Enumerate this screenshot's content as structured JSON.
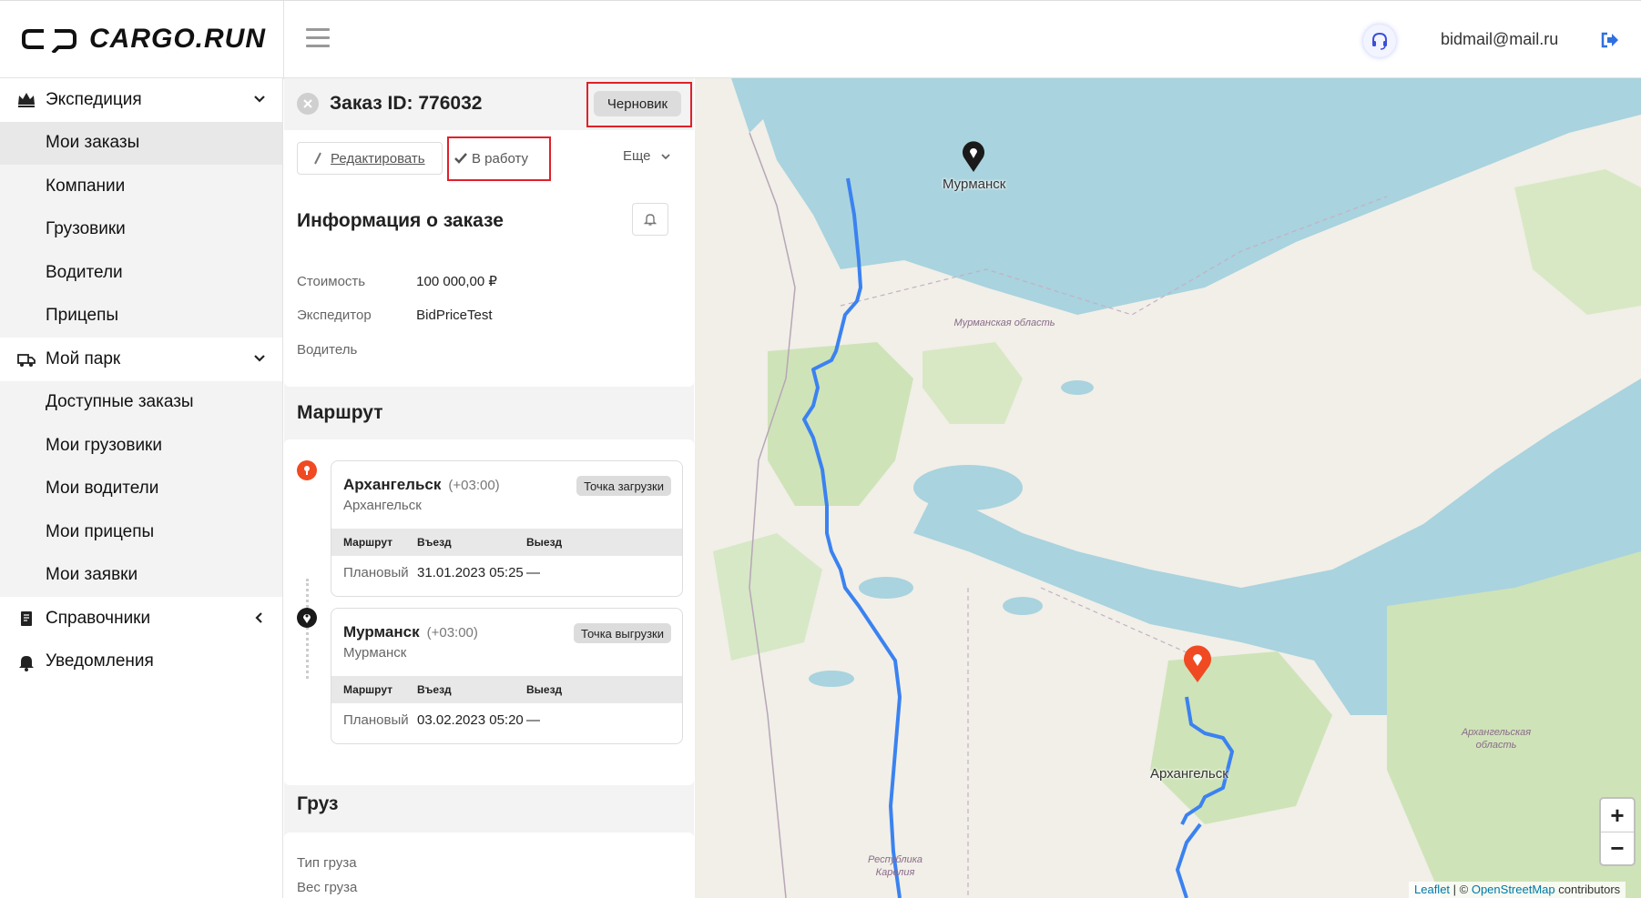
{
  "header": {
    "logo_text": "CARGO.RUN",
    "user_email": "bidmail@mail.ru"
  },
  "sidebar": {
    "items": [
      {
        "label": "Экспедиция",
        "icon": "crown-icon",
        "type": "parent",
        "chevron": "down"
      },
      {
        "label": "Мои заказы",
        "type": "child",
        "active": true
      },
      {
        "label": "Компании",
        "type": "child"
      },
      {
        "label": "Грузовики",
        "type": "child"
      },
      {
        "label": "Водители",
        "type": "child"
      },
      {
        "label": "Прицепы",
        "type": "child"
      },
      {
        "label": "Мой парк",
        "icon": "truck-icon",
        "type": "parent",
        "chevron": "down"
      },
      {
        "label": "Доступные заказы",
        "type": "child"
      },
      {
        "label": "Мои грузовики",
        "type": "child"
      },
      {
        "label": "Мои водители",
        "type": "child"
      },
      {
        "label": "Мои прицепы",
        "type": "child"
      },
      {
        "label": "Мои заявки",
        "type": "child"
      },
      {
        "label": "Справочники",
        "icon": "book-icon",
        "type": "parent",
        "chevron": "left"
      },
      {
        "label": "Уведомления",
        "icon": "bell-icon",
        "type": "parent"
      }
    ]
  },
  "order": {
    "title": "Заказ ID: 776032",
    "status": "Черновик",
    "edit_label": "Редактировать",
    "work_label": "В работу",
    "more_label": "Еще",
    "info_title": "Информация о заказе",
    "info": [
      {
        "key": "Стоимость",
        "value": "100 000,00 ₽"
      },
      {
        "key": "Экспедитор",
        "value": "BidPriceTest"
      },
      {
        "key": "Водитель",
        "value": ""
      }
    ],
    "route_title": "Маршрут",
    "route": [
      {
        "city": "Архангельск",
        "tz": "(+03:00)",
        "sub": "Архангельск",
        "badge": "Точка загрузки",
        "head": [
          "Маршрут",
          "Въезд",
          "Выезд"
        ],
        "row": [
          "Плановый",
          "31.01.2023 05:25",
          "—"
        ]
      },
      {
        "city": "Мурманск",
        "tz": "(+03:00)",
        "sub": "Мурманск",
        "badge": "Точка выгрузки",
        "head": [
          "Маршрут",
          "Въезд",
          "Выезд"
        ],
        "row": [
          "Плановый",
          "03.02.2023 05:20",
          "—"
        ]
      }
    ],
    "cargo_title": "Груз",
    "cargo": [
      {
        "key": "Тип груза"
      },
      {
        "key": "Вес груза"
      }
    ]
  },
  "map": {
    "labels": {
      "murmansk": "Мурманск",
      "arkhangelsk": "Архангельск",
      "region_murmansk": "Мурманская область",
      "region_arkhangelsk": "Архангельская область",
      "region_karelia": "Республика Карелия"
    },
    "zoom_in": "+",
    "zoom_out": "−",
    "attribution": {
      "leaflet": "Leaflet",
      "sep": " | © ",
      "osm": "OpenStreetMap",
      "suffix": " contributors"
    },
    "colors": {
      "water": "#a9d3de",
      "land": "#f1efe8",
      "forest": "#cfe3b8",
      "route": "#3b82f0",
      "start_pin": "#f04a23",
      "end_pin": "#1a1a1a"
    }
  }
}
